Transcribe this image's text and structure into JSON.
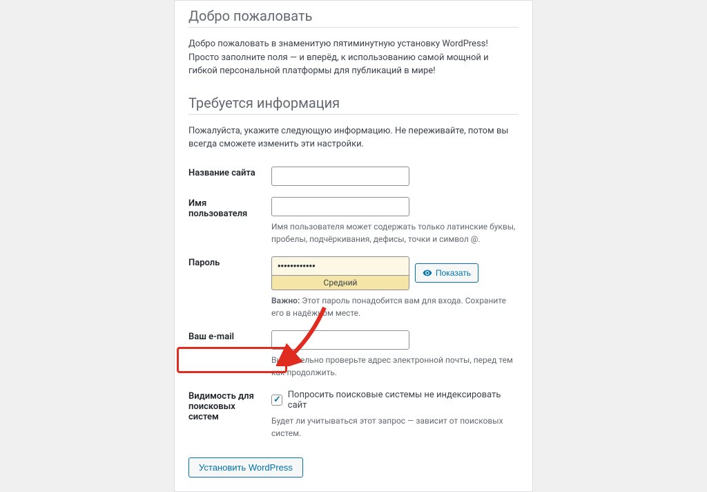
{
  "welcome": {
    "heading": "Добро пожаловать",
    "intro": "Добро пожаловать в знаменитую пятиминутную установку WordPress! Просто заполните поля — и вперёд, к использованию самой мощной и гибкой персональной платформы для публикаций в мире!"
  },
  "info": {
    "heading": "Требуется информация",
    "intro": "Пожалуйста, укажите следующую информацию. Не переживайте, потом вы всегда сможете изменить эти настройки."
  },
  "fields": {
    "site_title_label": "Название сайта",
    "site_title_value": "",
    "username_label": "Имя пользователя",
    "username_value": "",
    "username_hint": "Имя пользователя может содержать только латинские буквы, пробелы, подчёркивания, дефисы, точки и символ @.",
    "password_label": "Пароль",
    "password_value": "••••••••••••",
    "password_strength": "Средний",
    "show_password_label": "Показать",
    "password_important_label": "Важно:",
    "password_important_text": " Этот пароль понадобится вам для входа. Сохраните его в надёжном месте.",
    "email_label": "Ваш e-mail",
    "email_value": "",
    "email_hint": "Внимательно проверьте адрес электронной почты, перед тем как продолжить.",
    "seo_label_line1": "Видимость для",
    "seo_label_line2": "поисковых систем",
    "seo_checkbox_label": "Попросить поисковые системы не индексировать сайт",
    "seo_hint": "Будет ли учитываться этот запрос — зависит от поисковых систем."
  },
  "submit_label": "Установить WordPress"
}
